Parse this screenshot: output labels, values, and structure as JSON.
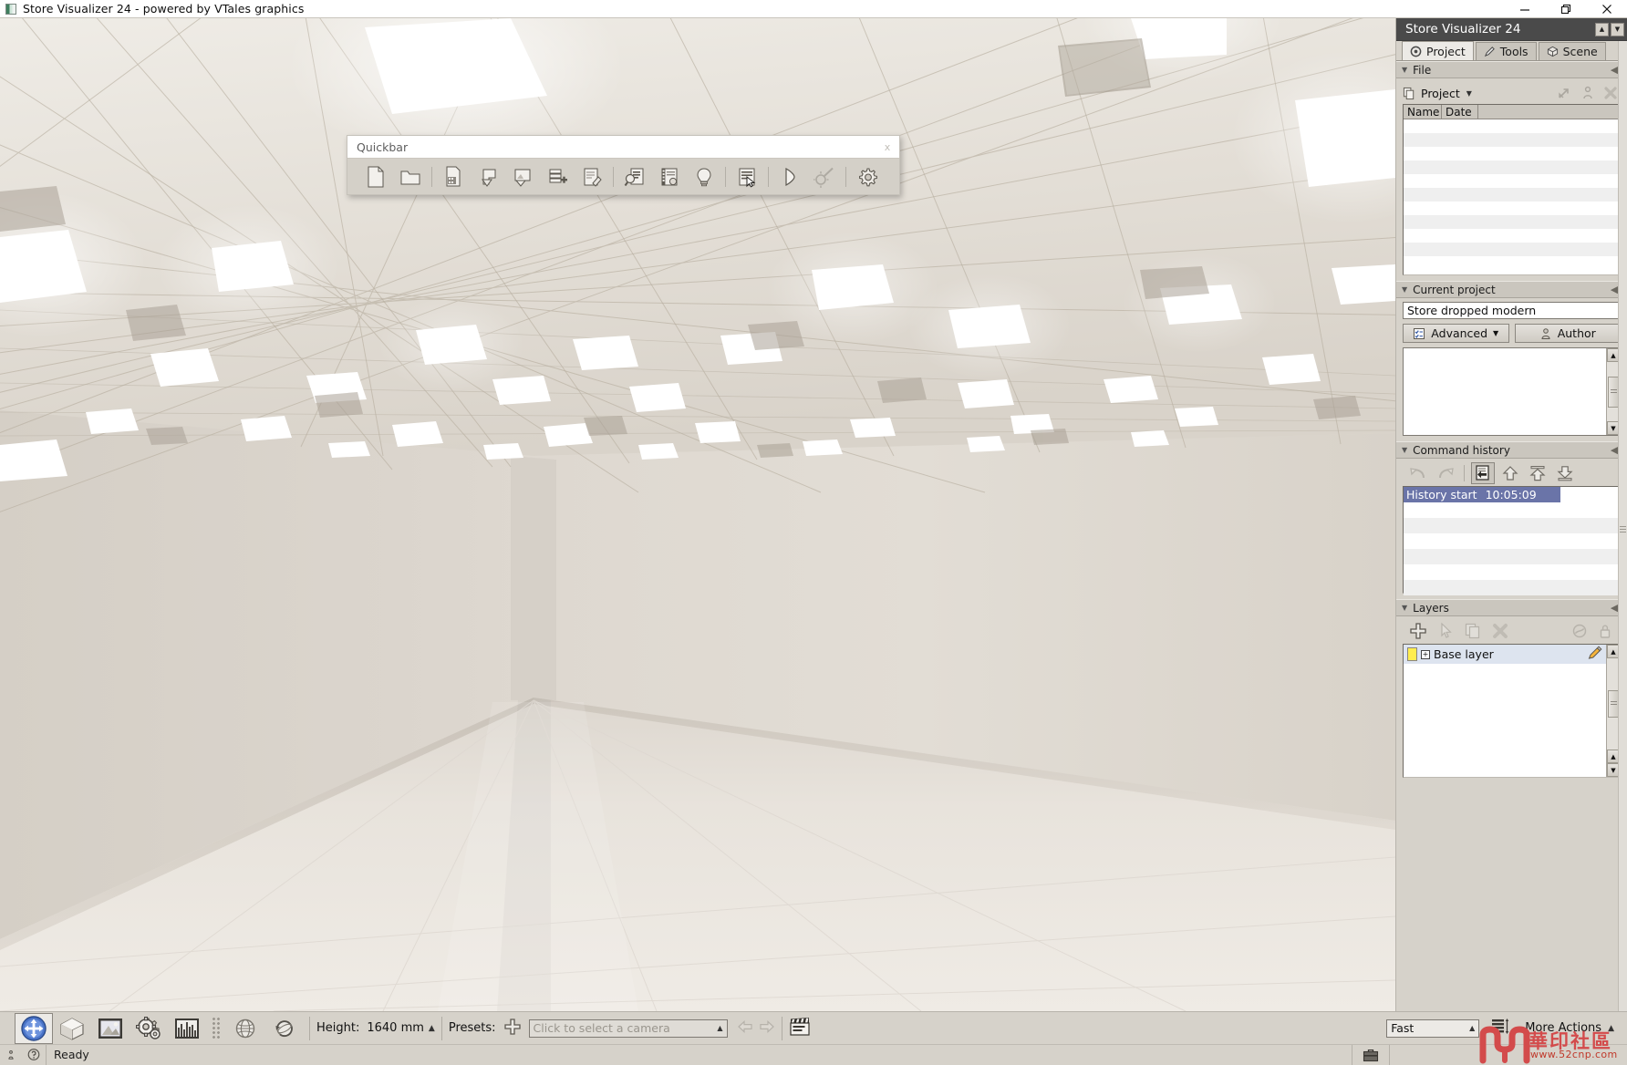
{
  "window": {
    "title": "Store Visualizer 24 - powered by VTales graphics",
    "app_icon": "app-logo-icon",
    "buttons": [
      {
        "name": "minimize-button",
        "glyph": "—"
      },
      {
        "name": "maximize-button",
        "glyph": "❐"
      },
      {
        "name": "close-button",
        "glyph": "✕"
      }
    ]
  },
  "quickbar": {
    "title": "Quickbar",
    "close_label": "x",
    "items": [
      {
        "name": "new-file-icon",
        "tip": "New"
      },
      {
        "name": "open-folder-icon",
        "tip": "Open"
      },
      {
        "sep": true
      },
      {
        "name": "import-page-icon",
        "tip": "Import"
      },
      {
        "name": "add-shape-icon",
        "tip": "Add shape"
      },
      {
        "name": "add-image-icon",
        "tip": "Add image"
      },
      {
        "name": "add-shelf-icon",
        "tip": "Add shelf"
      },
      {
        "name": "edit-note-icon",
        "tip": "Edit"
      },
      {
        "sep": true
      },
      {
        "name": "report-search-icon",
        "tip": "Report"
      },
      {
        "name": "film-catalog-icon",
        "tip": "Catalog"
      },
      {
        "name": "lightbulb-icon",
        "tip": "Lighting"
      },
      {
        "sep": true
      },
      {
        "name": "select-window-icon",
        "tip": "Select"
      },
      {
        "sep": true
      },
      {
        "name": "play-icon",
        "tip": "Play"
      },
      {
        "name": "settings-wand-icon",
        "tip": "Tools",
        "disabled": true
      },
      {
        "sep": true
      },
      {
        "name": "gear-icon",
        "tip": "Settings"
      }
    ]
  },
  "dock": {
    "title": "Store Visualizer 24",
    "title_buttons": [
      {
        "name": "dock-up-button",
        "glyph": "▲"
      },
      {
        "name": "dock-down-button",
        "glyph": "▼"
      }
    ],
    "tabs": [
      {
        "label": "Project",
        "icon": "gear-icon",
        "active": true
      },
      {
        "label": "Tools",
        "icon": "pencil-icon",
        "active": false
      },
      {
        "label": "Scene",
        "icon": "cube-icon",
        "active": false
      }
    ],
    "file_group": {
      "title": "File",
      "collapse_glyph": "◀|",
      "project_button": {
        "label": "Project",
        "icon": "copy-pages-icon",
        "caret": "▼"
      },
      "actions": [
        {
          "name": "export-arrow-icon"
        },
        {
          "name": "info-person-icon"
        },
        {
          "name": "delete-x-icon"
        }
      ],
      "columns": [
        "Name",
        "Date"
      ],
      "rows": []
    },
    "current_project_group": {
      "title": "Current project",
      "collapse_glyph": "◀|",
      "project_name": "Store dropped modern",
      "advanced_button": {
        "label": "Advanced",
        "icon": "checklist-icon",
        "caret": "▼"
      },
      "author_button": {
        "label": "Author",
        "icon": "person-icon"
      },
      "description": ""
    },
    "command_history_group": {
      "title": "Command history",
      "collapse_glyph": "◀|",
      "toolbar": [
        {
          "name": "undo-icon",
          "disabled": true
        },
        {
          "name": "redo-icon",
          "disabled": true
        },
        {
          "sep": true
        },
        {
          "name": "history-insert-icon",
          "active": true
        },
        {
          "name": "move-up-icon"
        },
        {
          "name": "move-to-top-icon"
        },
        {
          "name": "move-to-bottom-icon"
        }
      ],
      "entries": [
        {
          "label": "History start",
          "time": "10:05:09",
          "selected": true
        }
      ]
    },
    "layers_group": {
      "title": "Layers",
      "collapse_glyph": "◀|",
      "toolbar": [
        {
          "name": "add-layer-icon"
        },
        {
          "name": "pick-layer-icon",
          "disabled": true
        },
        {
          "name": "duplicate-layer-icon",
          "disabled": true
        },
        {
          "name": "delete-layer-icon",
          "disabled": true
        }
      ],
      "toolbar_right": [
        {
          "name": "visibility-icon",
          "disabled": true
        },
        {
          "name": "lock-icon",
          "disabled": true
        }
      ],
      "layers": [
        {
          "name": "Base layer",
          "color": "#ffed4e",
          "expander": "+",
          "edit_icon": "pencil-icon"
        }
      ]
    }
  },
  "bottombar": {
    "tools": [
      {
        "name": "navigate-tool",
        "icon": "navigate-icon",
        "active": true
      },
      {
        "name": "object-tool",
        "icon": "cube-icon",
        "active": false
      },
      {
        "name": "image-tool",
        "icon": "picture-icon",
        "active": false
      },
      {
        "name": "settings-tool",
        "icon": "gears-icon",
        "active": false
      },
      {
        "name": "analytics-tool",
        "icon": "bar-chart-icon",
        "active": false
      }
    ],
    "view_tools": [
      {
        "name": "globe-icon"
      },
      {
        "name": "orbit-refresh-icon"
      }
    ],
    "height_label": "Height:",
    "height_value": "1640 mm",
    "height_caret": "▲",
    "presets_label": "Presets:",
    "presets_add_icon": "plus-icon",
    "camera_placeholder": "Click to select a camera",
    "camera_caret": "▲",
    "nav_prev_icon": "arrow-left-icon",
    "nav_next_icon": "arrow-right-icon",
    "clapper_icon": "movie-clapper-icon",
    "quality_value": "Fast",
    "quality_caret": "▲",
    "layout_icon": "layout-rows-icon",
    "more_actions_label": "More Actions",
    "more_actions_caret": "▲"
  },
  "statusbar": {
    "info_icon": "info-icon",
    "help_icon": "help-icon",
    "message": "Ready",
    "briefcase_icon": "briefcase-icon"
  },
  "watermark": {
    "text": "華印社區",
    "url": "www.52cnp.com",
    "color": "#d34b4b"
  },
  "viewport": {
    "scene": "store-interior-3d-render",
    "colors": {
      "ceiling": "#e2ddd5",
      "wall_left": "#dcd6ce",
      "wall_right": "#e0dbd3",
      "floor": "#eae6e0",
      "light_panel": "#ffffff"
    }
  }
}
